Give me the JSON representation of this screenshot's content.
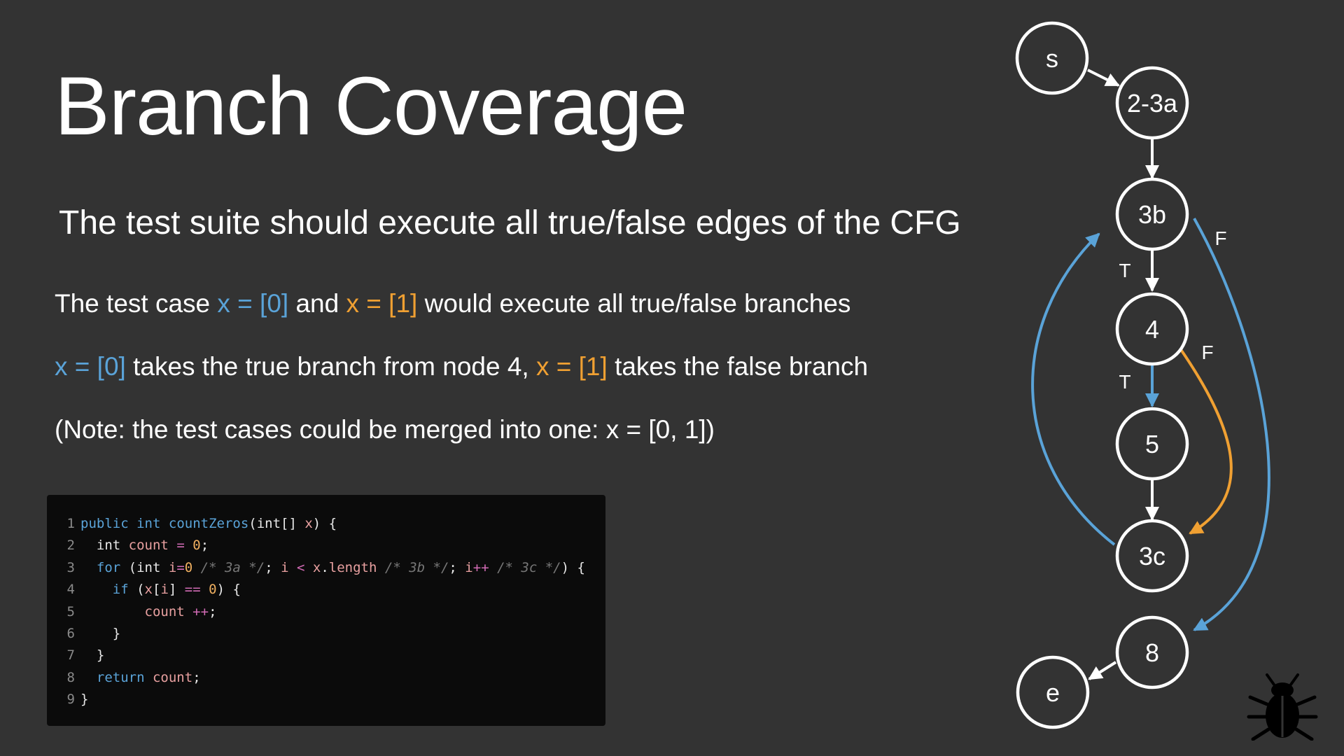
{
  "slide": {
    "title": "Branch Coverage",
    "subtitle": "The test suite should execute all true/false edges of the CFG",
    "para1": {
      "t1": "The test case ",
      "blue": "x = [0]",
      "t2": " and ",
      "orange": "x = [1]",
      "t3": " would execute all true/false branches"
    },
    "para2": {
      "blue": "x = [0]",
      "t1": " takes the true branch from node 4, ",
      "orange": "x = [1]",
      "t2": " takes the false branch"
    },
    "para3": "(Note: the test cases could be merged into one: x = [0, 1])"
  },
  "code": {
    "lines": [
      {
        "n": "1",
        "tokens": [
          [
            "kw",
            "public"
          ],
          [
            "pl",
            " "
          ],
          [
            "kw",
            "int"
          ],
          [
            "pl",
            " "
          ],
          [
            "fn",
            "countZeros"
          ],
          [
            "pl",
            "(int[] "
          ],
          [
            "var",
            "x"
          ],
          [
            "pl",
            ") {"
          ]
        ]
      },
      {
        "n": "2",
        "tokens": [
          [
            "pl",
            "  "
          ],
          [
            "pl",
            "int"
          ],
          [
            "pl",
            " "
          ],
          [
            "var",
            "count"
          ],
          [
            "pl",
            " "
          ],
          [
            "op",
            "="
          ],
          [
            "pl",
            " "
          ],
          [
            "num",
            "0"
          ],
          [
            "pl",
            ";"
          ]
        ]
      },
      {
        "n": "3",
        "tokens": [
          [
            "pl",
            "  "
          ],
          [
            "kw",
            "for"
          ],
          [
            "pl",
            " (int "
          ],
          [
            "var",
            "i"
          ],
          [
            "op",
            "="
          ],
          [
            "num",
            "0"
          ],
          [
            "pl",
            " "
          ],
          [
            "cm",
            "/* 3a */"
          ],
          [
            "pl",
            "; "
          ],
          [
            "var",
            "i"
          ],
          [
            "pl",
            " "
          ],
          [
            "op",
            "<"
          ],
          [
            "pl",
            " "
          ],
          [
            "var",
            "x"
          ],
          [
            "pl",
            "."
          ],
          [
            "var",
            "length"
          ],
          [
            "pl",
            " "
          ],
          [
            "cm",
            "/* 3b */"
          ],
          [
            "pl",
            "; "
          ],
          [
            "var",
            "i"
          ],
          [
            "op",
            "++"
          ],
          [
            "pl",
            " "
          ],
          [
            "cm",
            "/* 3c */"
          ],
          [
            "pl",
            ") {"
          ]
        ]
      },
      {
        "n": "4",
        "tokens": [
          [
            "pl",
            "    "
          ],
          [
            "kw",
            "if"
          ],
          [
            "pl",
            " ("
          ],
          [
            "var",
            "x"
          ],
          [
            "pl",
            "["
          ],
          [
            "var",
            "i"
          ],
          [
            "pl",
            "] "
          ],
          [
            "op",
            "=="
          ],
          [
            "pl",
            " "
          ],
          [
            "num",
            "0"
          ],
          [
            "pl",
            ") {"
          ]
        ]
      },
      {
        "n": "5",
        "tokens": [
          [
            "pl",
            "        "
          ],
          [
            "var",
            "count"
          ],
          [
            "pl",
            " "
          ],
          [
            "op",
            "++"
          ],
          [
            "pl",
            ";"
          ]
        ]
      },
      {
        "n": "6",
        "tokens": [
          [
            "pl",
            "    }"
          ]
        ]
      },
      {
        "n": "7",
        "tokens": [
          [
            "pl",
            "  }"
          ]
        ]
      },
      {
        "n": "8",
        "tokens": [
          [
            "pl",
            "  "
          ],
          [
            "kw",
            "return"
          ],
          [
            "pl",
            " "
          ],
          [
            "var",
            "count"
          ],
          [
            "pl",
            ";"
          ]
        ]
      },
      {
        "n": "9",
        "tokens": [
          [
            "pl",
            "}"
          ]
        ]
      }
    ]
  },
  "cfg": {
    "nodes": {
      "s": "s",
      "n23a": "2-3a",
      "n3b": "3b",
      "n4": "4",
      "n5": "5",
      "n3c": "3c",
      "n8": "8",
      "e": "e"
    },
    "edge_labels": {
      "t_3b_4": "T",
      "f_3b_8": "F",
      "t_4_5": "T",
      "f_4_3c": "F"
    },
    "colors": {
      "blue": "#5aa3d8",
      "orange": "#f0a032",
      "white": "#ffffff"
    }
  },
  "icons": {
    "bug": "bug-icon"
  }
}
